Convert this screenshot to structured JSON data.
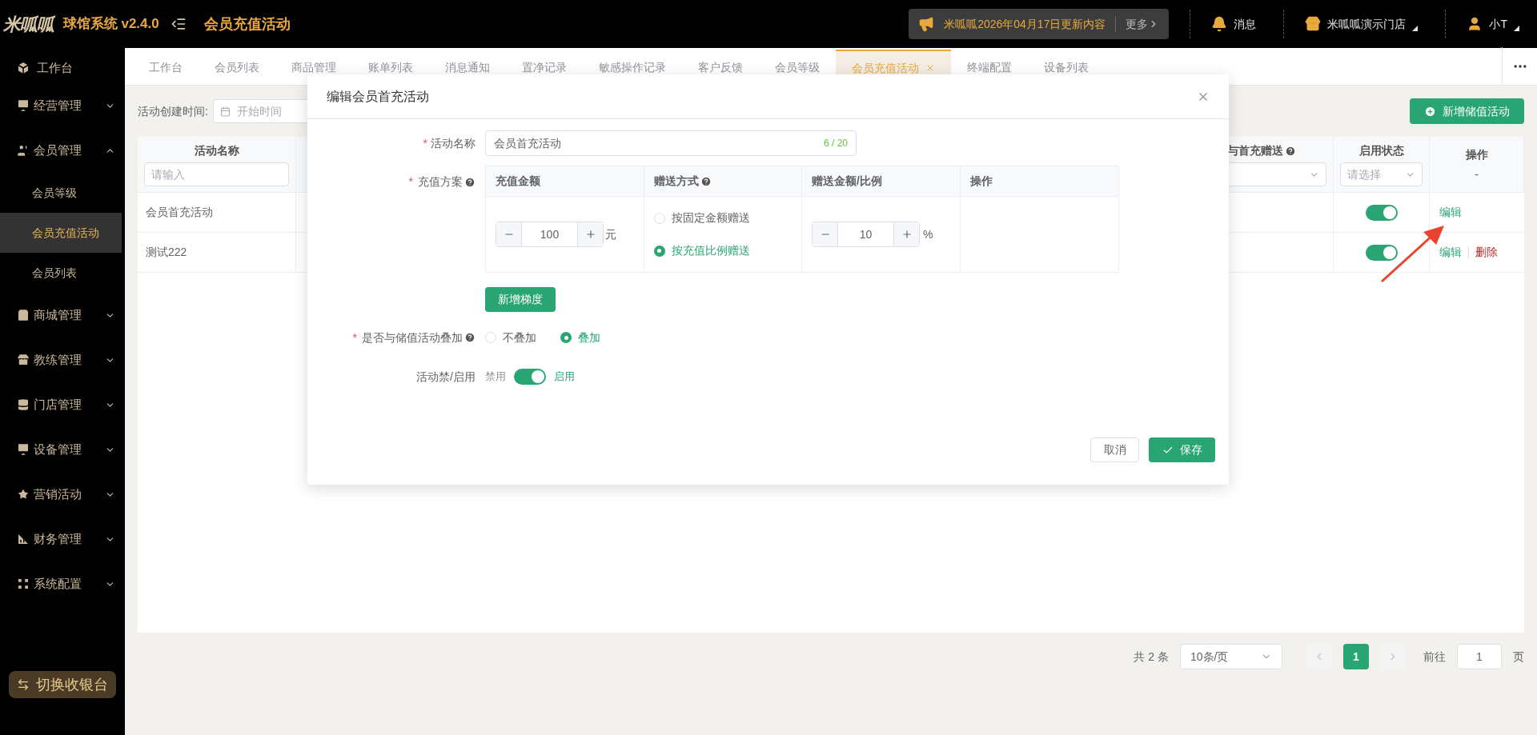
{
  "header": {
    "logo": "米呱呱",
    "system_name": "球馆系统 v2.4.0",
    "page_title": "会员充值活动",
    "notice": {
      "text": "米呱呱2026年04月17日更新内容",
      "more": "更多"
    },
    "actions": [
      {
        "kind": "message",
        "label": "消息"
      },
      {
        "kind": "store",
        "label": "米呱呱演示门店"
      },
      {
        "kind": "user",
        "label": "小T"
      }
    ]
  },
  "sidebar": {
    "home": {
      "label": "工作台"
    },
    "items": [
      {
        "kind": "chart",
        "label": "经营管理",
        "expanded": false
      },
      {
        "kind": "member",
        "label": "会员管理",
        "expanded": true,
        "children": [
          {
            "label": "会员等级",
            "selected": false
          },
          {
            "label": "会员充值活动",
            "selected": true
          },
          {
            "label": "会员列表",
            "selected": false
          }
        ]
      },
      {
        "kind": "shop",
        "label": "商城管理",
        "expanded": false
      },
      {
        "kind": "coach",
        "label": "教练管理",
        "expanded": false
      },
      {
        "kind": "store",
        "label": "门店管理",
        "expanded": false
      },
      {
        "kind": "chart",
        "label": "设备管理",
        "expanded": false
      },
      {
        "kind": "marketing",
        "label": "营销活动",
        "expanded": false
      },
      {
        "kind": "finance",
        "label": "财务管理",
        "expanded": false
      },
      {
        "kind": "system",
        "label": "系统配置",
        "expanded": false
      }
    ],
    "switch_button": "切换收银台"
  },
  "tabs": [
    {
      "label": "工作台",
      "selected": false
    },
    {
      "label": "会员列表",
      "selected": false
    },
    {
      "label": "商品管理",
      "selected": false
    },
    {
      "label": "账单列表",
      "selected": false
    },
    {
      "label": "消息通知",
      "selected": false
    },
    {
      "label": "置净记录",
      "selected": false
    },
    {
      "label": "敏感操作记录",
      "selected": false
    },
    {
      "label": "客户反馈",
      "selected": false
    },
    {
      "label": "会员等级",
      "selected": false
    },
    {
      "label": "会员充值活动",
      "selected": true
    },
    {
      "label": "终端配置",
      "selected": false
    },
    {
      "label": "设备列表",
      "selected": false
    }
  ],
  "filter": {
    "label": "活动创建时间:",
    "date_placeholder": "开始时间",
    "add_button": "新增储值活动"
  },
  "table": {
    "columns": [
      {
        "label": "活动名称",
        "help": false,
        "filter": {
          "kind": "input",
          "placeholder": "请输入"
        }
      },
      {
        "label": "与首充赠送",
        "help": true,
        "filter": {
          "kind": "select"
        }
      },
      {
        "label": "启用状态",
        "help": false,
        "filter": {
          "kind": "select",
          "placeholder": "请选择"
        }
      },
      {
        "label": "操作",
        "help": false,
        "filter": {
          "kind": "text",
          "placeholder": "-"
        }
      }
    ],
    "rows": [
      {
        "name": "会员首充活动",
        "enabled": true,
        "actions": [
          {
            "kind": "edit",
            "label": "编辑"
          }
        ]
      },
      {
        "name": "测试222",
        "enabled": true,
        "actions": [
          {
            "kind": "edit",
            "label": "编辑"
          },
          {
            "kind": "delete",
            "label": "删除"
          }
        ]
      }
    ]
  },
  "pagination": {
    "total": "共 2 条",
    "page_size": "10条/页",
    "pages": [
      {
        "label": "1",
        "selected": true
      }
    ],
    "goto_label": "前往",
    "goto_value": "1",
    "page_unit": "页"
  },
  "modal": {
    "title": "编辑会员首充活动",
    "name_field": {
      "label": "活动名称",
      "required_mark": "*",
      "value": "会员首充活动",
      "counter": "6 / 20"
    },
    "plan": {
      "label": "充值方案",
      "required_mark": "*",
      "help": true,
      "columns": [
        {
          "label": "充值金额",
          "help": false
        },
        {
          "label": "赠送方式",
          "help": true
        },
        {
          "label": "赠送金额/比例",
          "help": false
        },
        {
          "label": "操作",
          "help": false
        }
      ],
      "tiers": [
        {
          "amount": "100",
          "amount_unit": "元",
          "gift_modes": [
            {
              "label": "按固定金额赠送",
              "selected": false
            },
            {
              "label": "按充值比例赠送",
              "selected": true
            }
          ],
          "gift_value": "10",
          "gift_unit": "%"
        }
      ],
      "add_button": "新增梯度"
    },
    "stack": {
      "label": "是否与储值活动叠加",
      "required_mark": "*",
      "help": true,
      "options": [
        {
          "label": "不叠加",
          "selected": false
        },
        {
          "label": "叠加",
          "selected": true
        }
      ]
    },
    "toggle": {
      "label": "活动禁/启用",
      "off_label": "禁用",
      "on_label": "启用",
      "on": true
    },
    "buttons": {
      "cancel": "取消",
      "save": "保存"
    }
  }
}
